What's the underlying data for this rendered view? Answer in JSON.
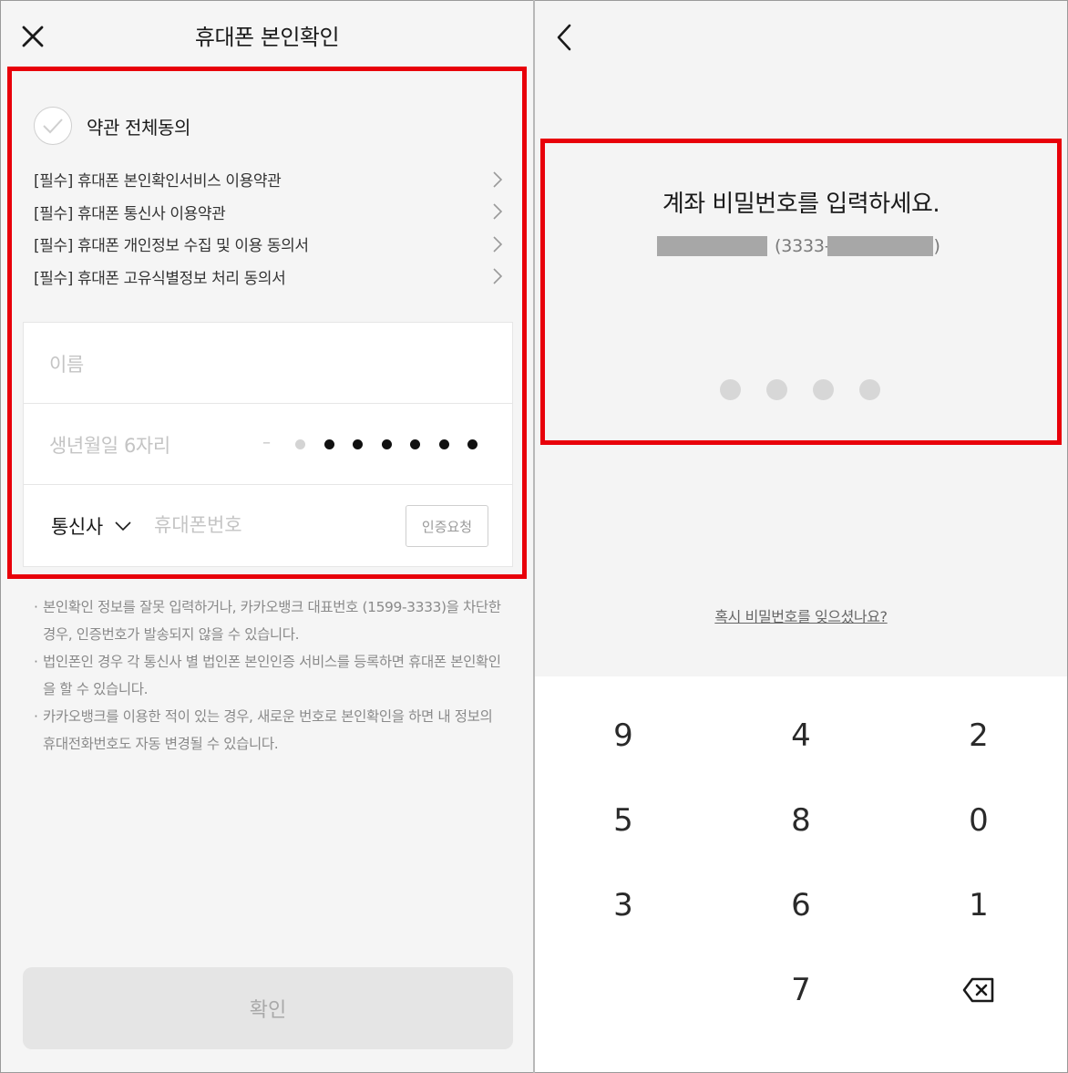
{
  "left": {
    "header": {
      "title": "휴대폰 본인확인",
      "close_icon": "close-icon"
    },
    "agree_all": {
      "label": "약관 전체동의",
      "checked": false
    },
    "terms": [
      {
        "label": "[필수] 휴대폰 본인확인서비스 이용약관"
      },
      {
        "label": "[필수] 휴대폰 통신사 이용약관"
      },
      {
        "label": "[필수] 휴대폰 개인정보 수집 및 이용 동의서"
      },
      {
        "label": "[필수] 휴대폰 고유식별정보 처리 동의서"
      }
    ],
    "form": {
      "name_placeholder": "이름",
      "birth_placeholder": "생년월일 6자리",
      "birth_dash": "–",
      "carrier_label": "통신사",
      "phone_placeholder": "휴대폰번호",
      "verify_button": "인증요청"
    },
    "notes": [
      "본인확인 정보를 잘못 입력하거나, 카카오뱅크 대표번호 (1599-3333)을 차단한 경우, 인증번호가 발송되지 않을 수 있습니다.",
      "법인폰인 경우 각 통신사 별 법인폰 본인인증 서비스를 등록하면 휴대폰 본인확인을 할 수 있습니다.",
      "카카오뱅크를 이용한 적이 있는 경우, 새로운 번호로 본인확인을 하면 내 정보의 휴대전화번호도 자동 변경될 수 있습니다."
    ],
    "note_bullet": "·",
    "confirm_button": "확인"
  },
  "right": {
    "back_icon": "chevron-left-icon",
    "title": "계좌 비밀번호를 입력하세요.",
    "account_prefix": "(3333-",
    "account_suffix": ")",
    "pin_length": 4,
    "forgot_link": "혹시 비밀번호를 잊으셨나요?",
    "keypad": [
      "9",
      "4",
      "2",
      "5",
      "8",
      "0",
      "3",
      "6",
      "1",
      "",
      "7",
      "⌫"
    ]
  },
  "colors": {
    "highlight": "#e8000a",
    "panel_bg": "#f5f5f5",
    "placeholder": "#c4c4c4",
    "redaction": "#a7a7a7"
  }
}
